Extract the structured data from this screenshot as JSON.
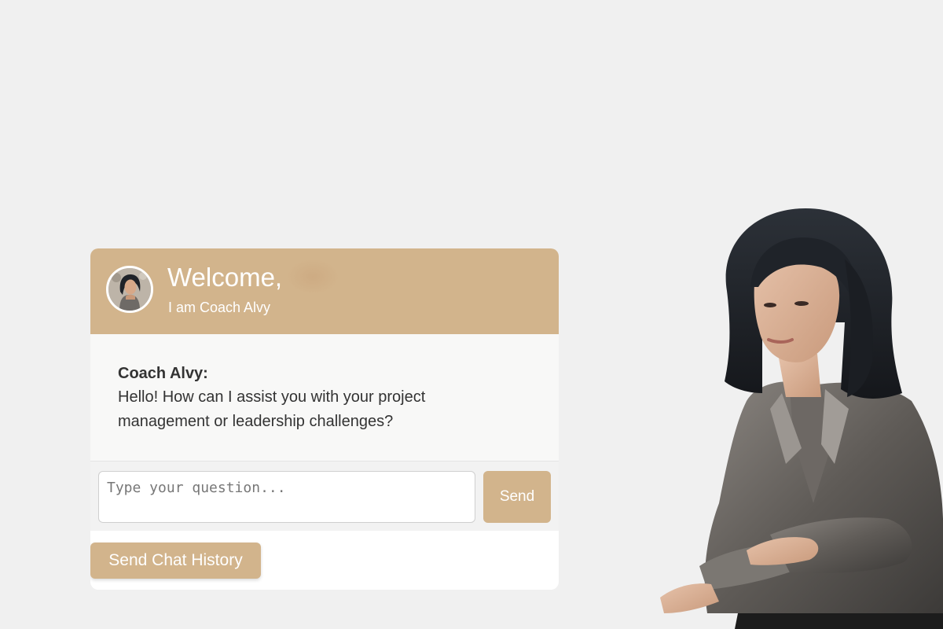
{
  "header": {
    "welcome": "Welcome,",
    "subtitle": "I am Coach Alvy"
  },
  "messages": [
    {
      "sender": "Coach Alvy:",
      "text": "Hello! How can I assist you with your project management or leadership challenges?"
    }
  ],
  "input": {
    "placeholder": "Type your question...",
    "value": ""
  },
  "buttons": {
    "send": "Send",
    "send_history": "Send Chat History"
  },
  "colors": {
    "accent": "#d2b48c",
    "background": "#f0f0f0",
    "text": "#333333"
  },
  "icons": {
    "avatar": "coach-avatar-icon",
    "figure": "coach-illustration"
  }
}
